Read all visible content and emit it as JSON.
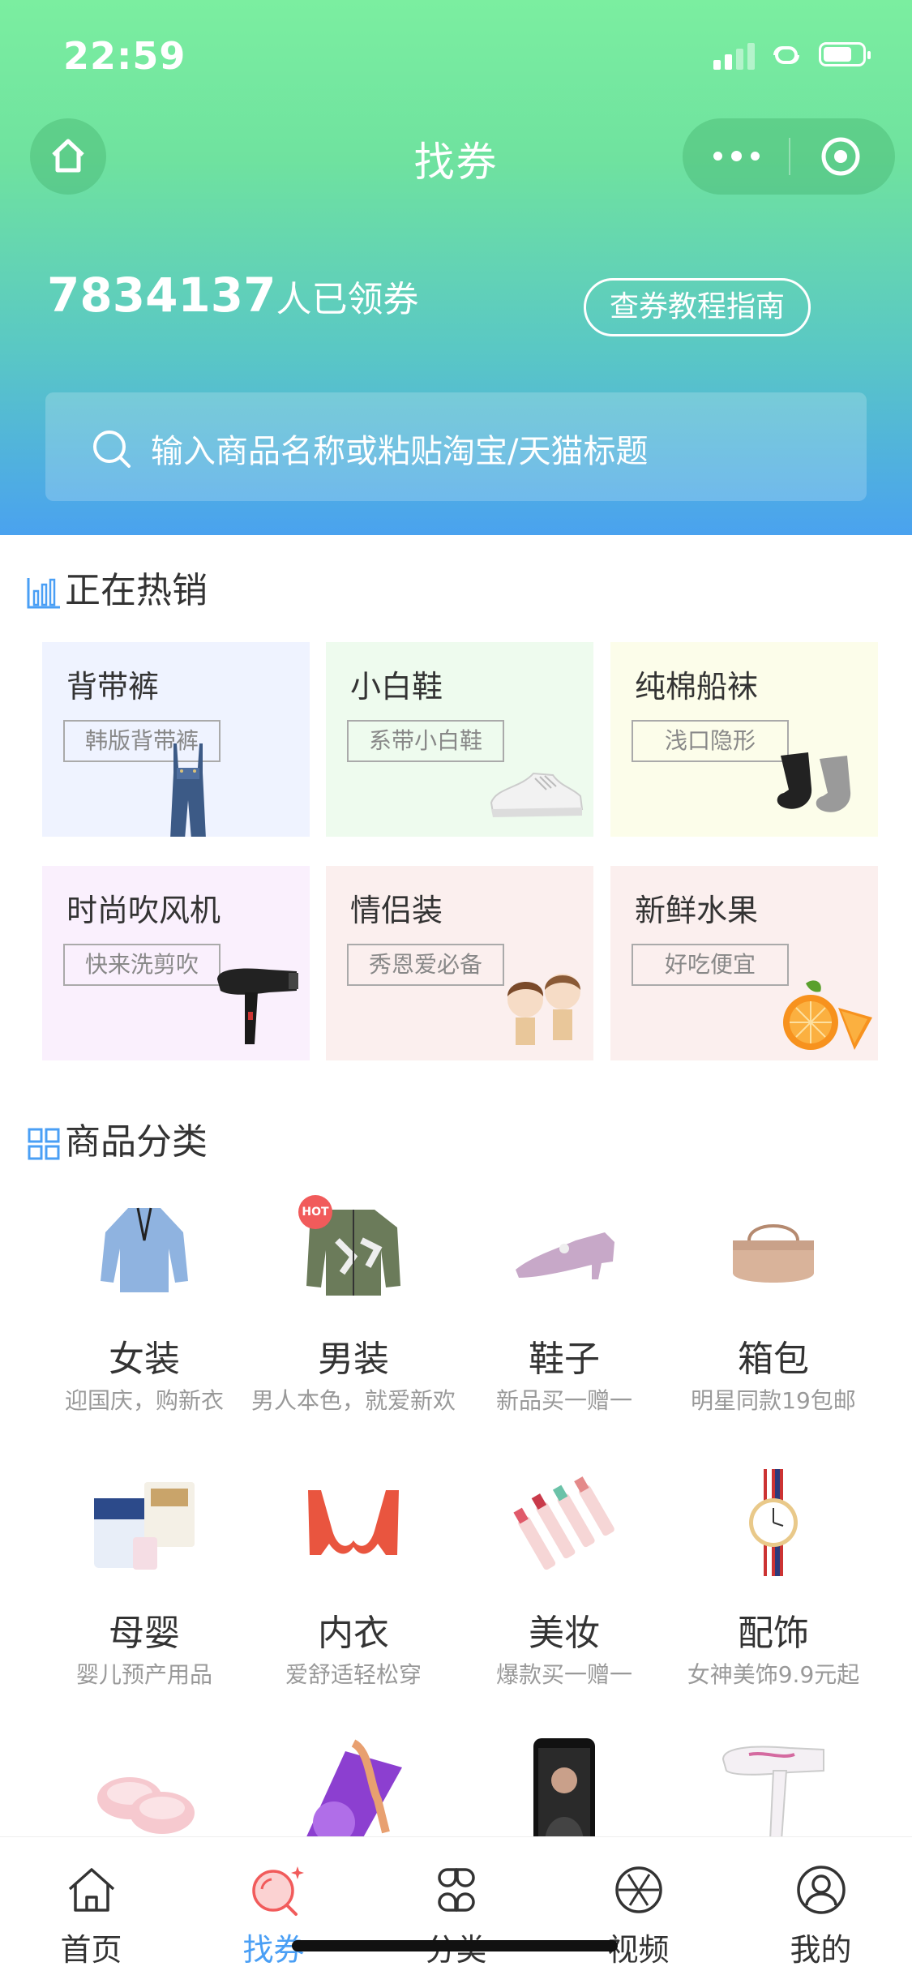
{
  "status": {
    "time": "22:59"
  },
  "nav": {
    "title": "找券"
  },
  "hero": {
    "count": "7834137",
    "count_suffix": "人已领券",
    "guide_button": "查券教程指南"
  },
  "search": {
    "placeholder": "输入商品名称或粘贴淘宝/天猫标题"
  },
  "hot": {
    "title": "正在热销",
    "items": [
      {
        "title": "背带裤",
        "tag": "韩版背带裤",
        "bg": "#eff3ff",
        "icon": "overalls-image"
      },
      {
        "title": "小白鞋",
        "tag": "系带小白鞋",
        "bg": "#eefbee",
        "icon": "white-sneaker-image"
      },
      {
        "title": "纯棉船袜",
        "tag": "浅口隐形",
        "bg": "#fcfdea",
        "icon": "socks-image"
      },
      {
        "title": "时尚吹风机",
        "tag": "快来洗剪吹",
        "bg": "#faf0fd",
        "icon": "hair-dryer-image"
      },
      {
        "title": "情侣装",
        "tag": "秀恩爱必备",
        "bg": "#fbefee",
        "icon": "couple-image"
      },
      {
        "title": "新鲜水果",
        "tag": "好吃便宜",
        "bg": "#fbefee",
        "icon": "orange-image"
      }
    ]
  },
  "categories": {
    "title": "商品分类",
    "items": [
      {
        "name": "女装",
        "sub": "迎国庆，购新衣",
        "icon": "blouse-image"
      },
      {
        "name": "男装",
        "sub": "男人本色，就爱新欢",
        "icon": "jacket-image",
        "badge": "HOT"
      },
      {
        "name": "鞋子",
        "sub": "新品买一赠一",
        "icon": "heel-shoe-image"
      },
      {
        "name": "箱包",
        "sub": "明星同款19包邮",
        "icon": "handbag-image"
      },
      {
        "name": "母婴",
        "sub": "婴儿预产用品",
        "icon": "baby-products-image"
      },
      {
        "name": "内衣",
        "sub": "爱舒适轻松穿",
        "icon": "bra-image"
      },
      {
        "name": "美妆",
        "sub": "爆款买一赠一",
        "icon": "lipstick-image"
      },
      {
        "name": "配饰",
        "sub": "女神美饰9.9元起",
        "icon": "watch-image"
      },
      {
        "name": "",
        "sub": "",
        "icon": "slippers-image"
      },
      {
        "name": "",
        "sub": "",
        "icon": "fitness-image"
      },
      {
        "name": "",
        "sub": "",
        "icon": "phone-image"
      },
      {
        "name": "",
        "sub": "",
        "icon": "dryer-image"
      }
    ]
  },
  "tabbar": {
    "items": [
      {
        "label": "首页",
        "icon": "home-icon"
      },
      {
        "label": "找券",
        "icon": "coupon-search-icon",
        "active": true
      },
      {
        "label": "分类",
        "icon": "category-icon"
      },
      {
        "label": "视频",
        "icon": "video-icon"
      },
      {
        "label": "我的",
        "icon": "profile-icon"
      }
    ],
    "active_color": "#4a9ff5"
  },
  "colors": {
    "header_top": "#7beea0",
    "header_bottom": "#4aa2ef",
    "accent": "#4a9ff5"
  }
}
